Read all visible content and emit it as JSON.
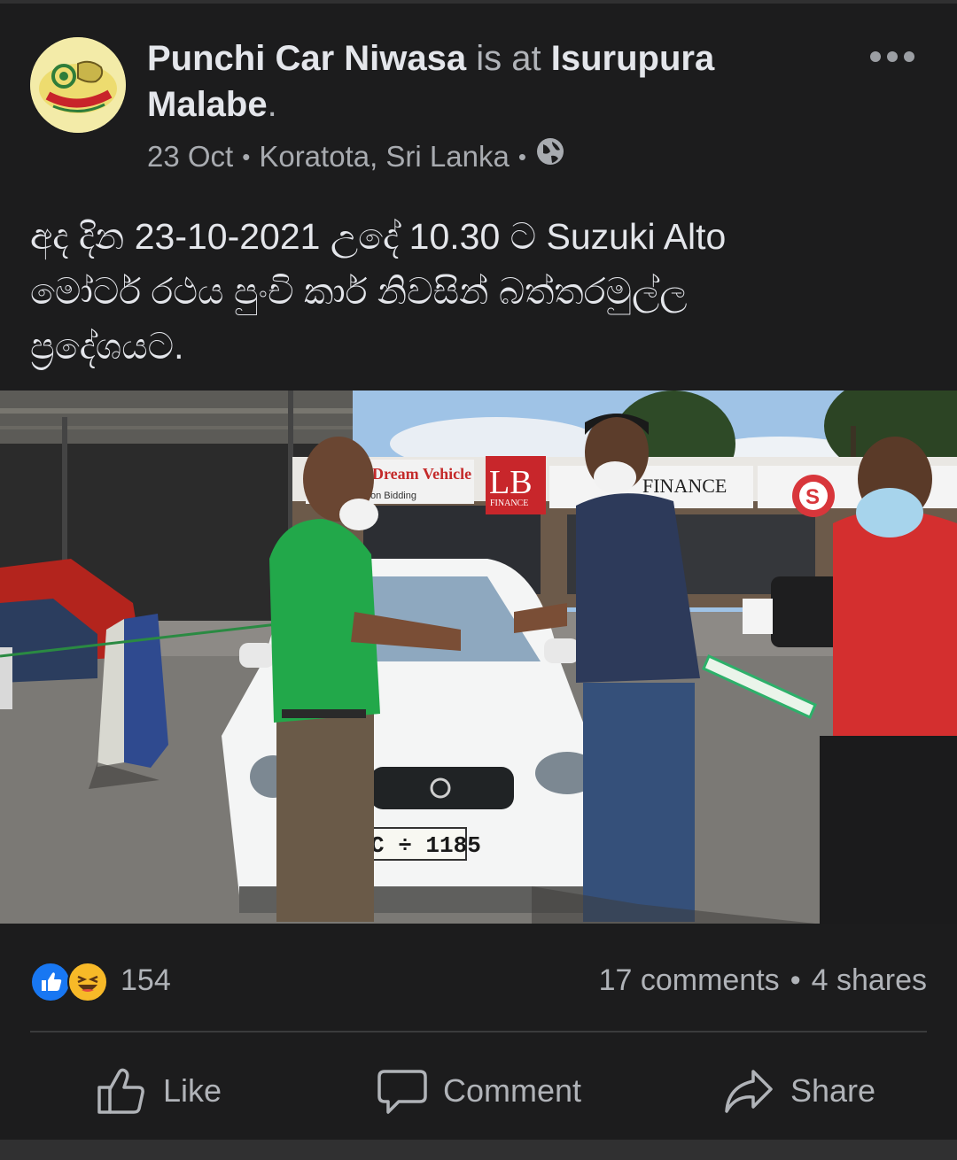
{
  "post": {
    "author": "Punchi Car Niwasa",
    "connector": "is at",
    "place": "Isurupura Malabe",
    "period": ".",
    "date": "23 Oct",
    "location": "Koratota, Sri Lanka",
    "separator": "•",
    "privacy_icon": "globe-icon",
    "more_icon": "more-options-icon",
    "text_line1": "අද දින 23-10-2021 උදේ 10.30 ට  Suzuki Alto",
    "text_line2": "මෝටර් රථය පුංචි කාර් නිවසින් බත්තරමුල්ල",
    "text_line3": "ප්‍රදේශයට."
  },
  "photo": {
    "signs": {
      "dream_vehicle": "Dream Vehicle",
      "bidding": "on Bidding",
      "lb": "LB",
      "lb_finance": "FINANCE",
      "finance": "FINANCE",
      "s_logo": "S",
      "plate": "C ÷ 1185"
    }
  },
  "stats": {
    "reaction_icons": [
      "like-reaction-icon",
      "haha-reaction-icon"
    ],
    "reaction_count": "154",
    "comments": "17 comments",
    "dot": "•",
    "shares": "4 shares"
  },
  "actions": {
    "like": "Like",
    "comment": "Comment",
    "share": "Share"
  },
  "colors": {
    "background": "#1c1c1d",
    "text": "#e4e6eb",
    "secondary": "#b0b3b8",
    "like_blue": "#1877f2",
    "haha_yellow": "#f7b928"
  }
}
